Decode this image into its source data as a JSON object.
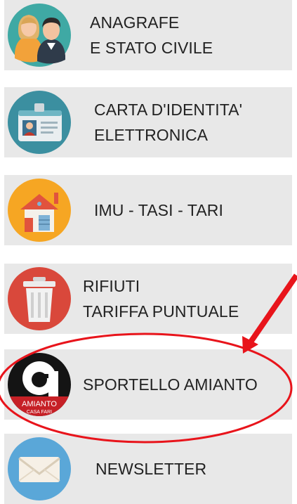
{
  "menu": {
    "items": [
      {
        "lines": [
          "ANAGRAFE",
          "E STATO CIVILE"
        ],
        "icon": "people-icon"
      },
      {
        "lines": [
          "CARTA D'IDENTITA'",
          "ELETTRONICA"
        ],
        "icon": "id-card-icon"
      },
      {
        "lines": [
          "IMU - TASI - TARI"
        ],
        "icon": "house-icon"
      },
      {
        "lines": [
          "RIFIUTI",
          "TARIFFA PUNTUALE"
        ],
        "icon": "trash-bin-icon"
      },
      {
        "lines": [
          "SPORTELLO AMIANTO"
        ],
        "icon": "amianto-logo-icon",
        "logo_text": "AMIANTO",
        "logo_subtext": "CASA FARI"
      },
      {
        "lines": [
          "NEWSLETTER"
        ],
        "icon": "envelope-icon"
      }
    ]
  },
  "colors": {
    "tile_background": "#e8e8e8",
    "highlight_annotation": "#e8141b"
  }
}
